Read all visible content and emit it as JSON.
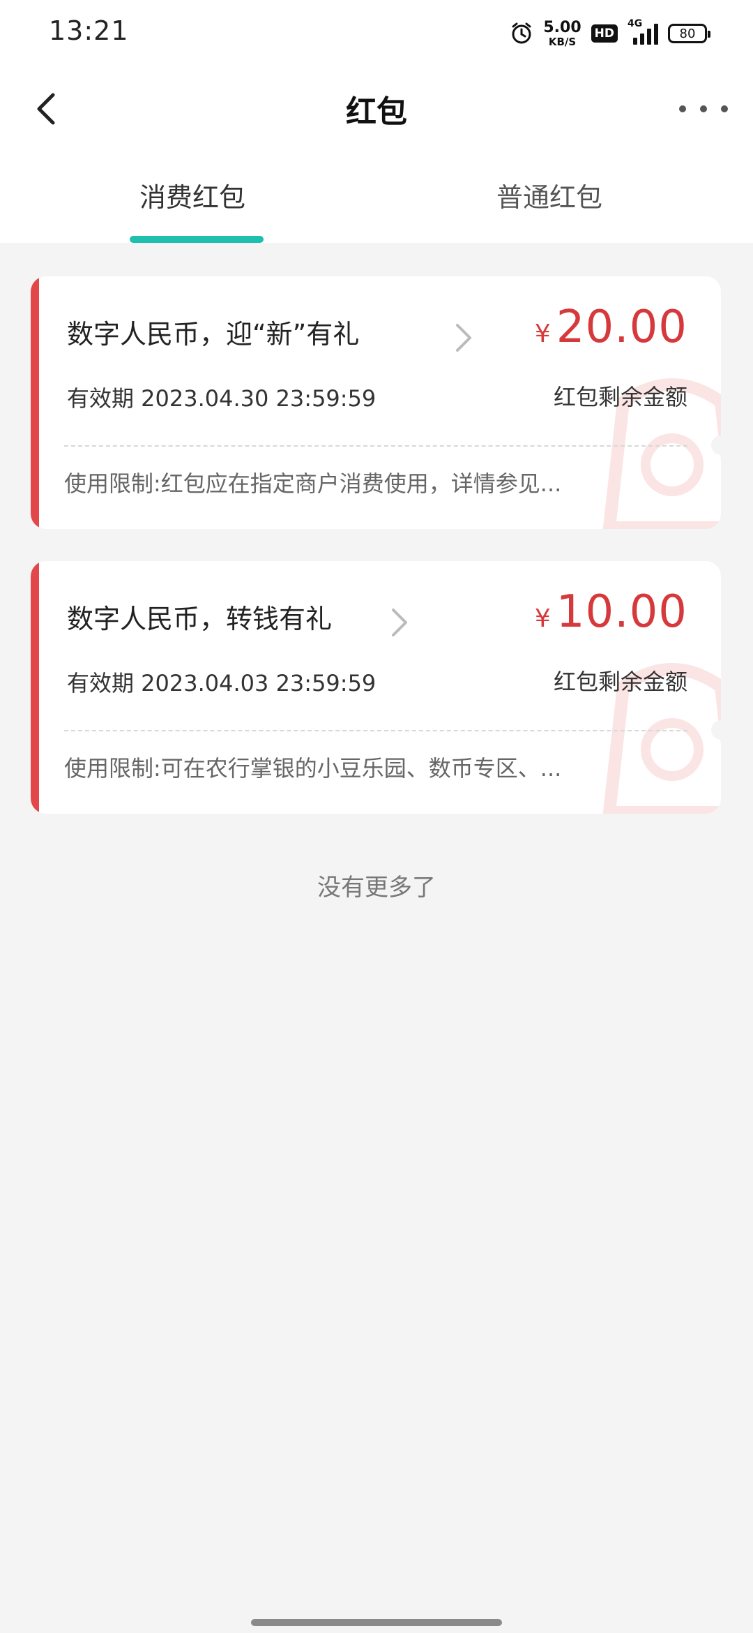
{
  "status": {
    "time": "13:21",
    "speed_value": "5.00",
    "speed_unit": "KB/S",
    "hd": "HD",
    "network": "4G",
    "battery": "80"
  },
  "nav": {
    "title": "红包"
  },
  "tabs": [
    {
      "label": "消费红包",
      "active": true
    },
    {
      "label": "普通红包",
      "active": false
    }
  ],
  "cards": [
    {
      "title": "数字人民币，迎“新”有礼",
      "currency": "¥",
      "amount": "20.00",
      "expiry": "有效期 2023.04.30 23:59:59",
      "remain_label": "红包剩余金额",
      "limit": "使用限制:红包应在指定商户消费使用，详情参见..."
    },
    {
      "title": "数字人民币，转钱有礼",
      "currency": "¥",
      "amount": "10.00",
      "expiry": "有效期 2023.04.03 23:59:59",
      "remain_label": "红包剩余金额",
      "limit": "使用限制:可在农行掌银的小豆乐园、数币专区、..."
    }
  ],
  "footer": {
    "no_more": "没有更多了"
  },
  "colors": {
    "accent_red": "#e3474a",
    "amount_red": "#d6393c",
    "tab_indicator": "#1dbfae"
  }
}
